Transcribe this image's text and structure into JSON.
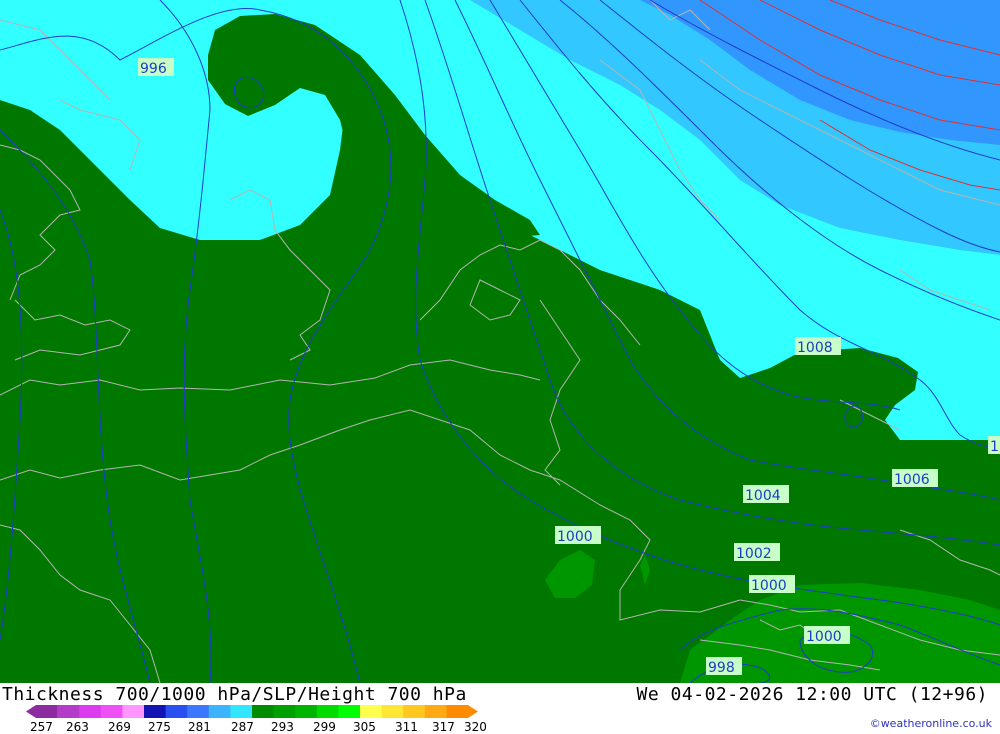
{
  "title": "Thickness 700/1000 hPa/SLP/Height 700 hPa",
  "datetime": "We 04-02-2026 12:00 UTC (12+96)",
  "credit": "©weatheronline.co.uk",
  "legend": {
    "ticks": [
      "257",
      "263",
      "269",
      "275",
      "281",
      "287",
      "293",
      "299",
      "305",
      "311",
      "317",
      "320"
    ],
    "colors": [
      "#8c2ca0",
      "#b43cc8",
      "#dc3cf0",
      "#f050f8",
      "#ff96ff",
      "#1414b4",
      "#2850f0",
      "#3c78ff",
      "#3cb4ff",
      "#32e6ff",
      "#008c00",
      "#00a000",
      "#00b400",
      "#00dc00",
      "#00ff00",
      "#ffff50",
      "#ffe632",
      "#ffc81e",
      "#ffaa14",
      "#ff8c00"
    ]
  },
  "isobar_labels": [
    "996",
    "1008",
    "1004",
    "1006",
    "1000",
    "1002",
    "1000",
    "1000",
    "998",
    "1"
  ],
  "colors": {
    "green_dark": "#007800",
    "green_mid": "#009600",
    "cyan": "#32ffff",
    "light_blue": "#32c8ff",
    "blue": "#3296ff",
    "isobar": "#1e3cc8",
    "coast": "#b4b4b4",
    "height": "#e03030"
  }
}
